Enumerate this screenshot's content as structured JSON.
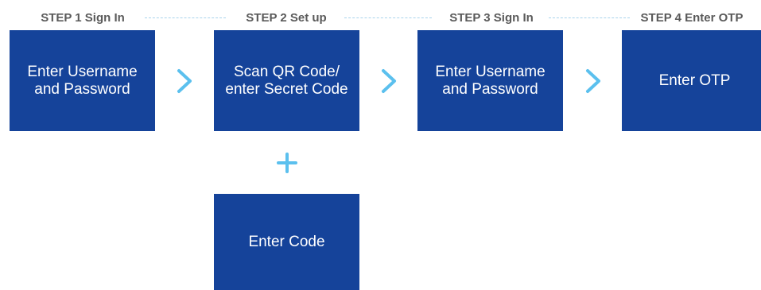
{
  "steps": [
    {
      "label": "STEP 1 Sign In",
      "box": [
        "Enter Username",
        "and Password"
      ]
    },
    {
      "label": "STEP 2 Set up",
      "box": [
        "Scan QR Code/",
        "enter Secret Code"
      ],
      "extra_box": [
        "Enter Code"
      ]
    },
    {
      "label": "STEP 3 Sign In",
      "box": [
        "Enter Username",
        "and Password"
      ]
    },
    {
      "label": "STEP 4 Enter OTP",
      "box": [
        "Enter OTP"
      ]
    }
  ],
  "colors": {
    "box_fill": "#15439a",
    "box_text": "#ffffff",
    "step_label": "#5a5a5a",
    "connector": "#5bc0ee",
    "dashed_line": "#a9d3ec"
  },
  "icons": {
    "arrow": "chevron-right-icon",
    "join": "plus-icon"
  }
}
